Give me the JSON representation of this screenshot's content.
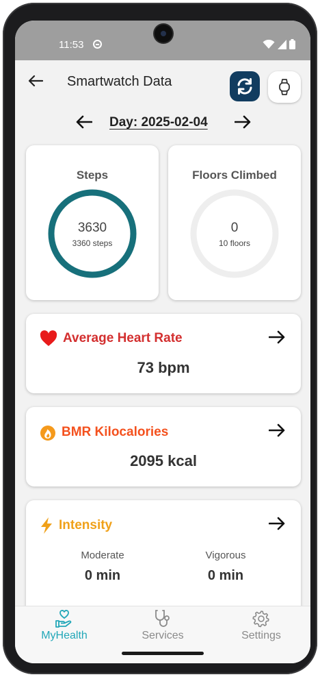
{
  "status_bar": {
    "time": "11:53"
  },
  "header": {
    "title": "Smartwatch Data"
  },
  "date_nav": {
    "label": "Day: 2025-02-04"
  },
  "steps_card": {
    "title": "Steps",
    "value": "3630",
    "sub": "3360 steps",
    "ring_color": "#17707b",
    "progress_fraction": 1.0
  },
  "floors_card": {
    "title": "Floors Climbed",
    "value": "0",
    "sub": "10 floors",
    "ring_color": "#eeeeee",
    "progress_fraction": 0
  },
  "heart_card": {
    "title": "Average Heart Rate",
    "value": "73 bpm",
    "color": "#d32f2f",
    "icon": "heart-icon"
  },
  "bmr_card": {
    "title": "BMR Kilocalories",
    "value": "2095 kcal",
    "color": "#f4511e",
    "icon": "flame-icon"
  },
  "intensity_card": {
    "title": "Intensity",
    "color": "#f0a11a",
    "icon": "lightning-icon",
    "moderate_label": "Moderate",
    "moderate_value": "0 min",
    "vigorous_label": "Vigorous",
    "vigorous_value": "0 min"
  },
  "bottom_nav": {
    "items": [
      {
        "label": "MyHealth",
        "icon": "hand-heart-icon",
        "active": true
      },
      {
        "label": "Services",
        "icon": "stethoscope-icon",
        "active": false
      },
      {
        "label": "Settings",
        "icon": "gear-icon",
        "active": false
      }
    ],
    "active_color": "#22a7b8",
    "inactive_color": "#8a8a8a"
  }
}
